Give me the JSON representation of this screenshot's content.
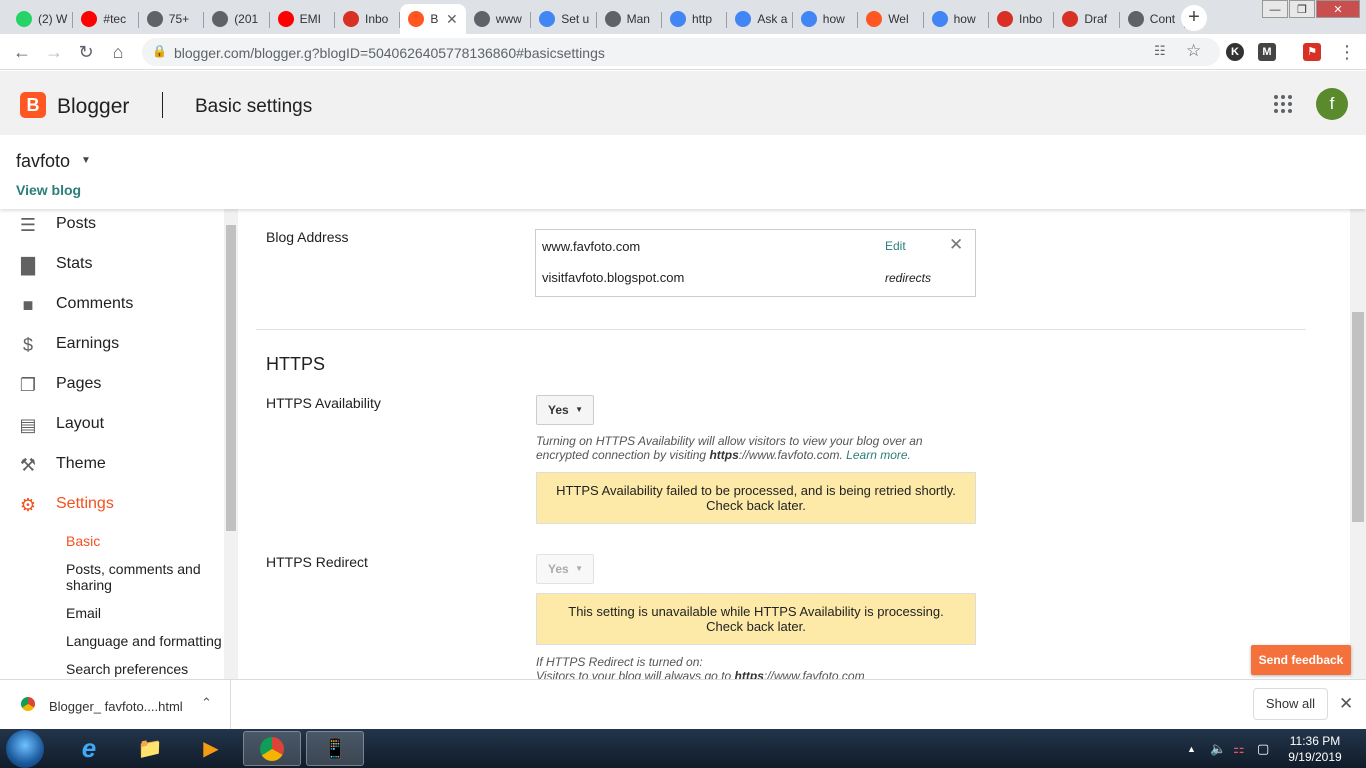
{
  "browser": {
    "tabs": [
      {
        "label": "(2) W",
        "icon": "whatsapp-icon",
        "color": "#25d366"
      },
      {
        "label": "#tec",
        "icon": "youtube-icon",
        "color": "#ff0000"
      },
      {
        "label": "75+",
        "icon": "globe-icon",
        "color": "#5f6368"
      },
      {
        "label": "(201",
        "icon": "globe-icon",
        "color": "#5f6368"
      },
      {
        "label": "EMI",
        "icon": "youtube-icon",
        "color": "#ff0000"
      },
      {
        "label": "Inbo",
        "icon": "gmail-icon",
        "color": "#d93025"
      },
      {
        "label": "B",
        "icon": "blogger-icon",
        "color": "#ff5722"
      },
      {
        "label": "www",
        "icon": "globe-icon",
        "color": "#5f6368"
      },
      {
        "label": "Set u",
        "icon": "google-icon",
        "color": "#4285f4"
      },
      {
        "label": "Man",
        "icon": "globe-icon",
        "color": "#5f6368"
      },
      {
        "label": "http",
        "icon": "google-icon",
        "color": "#4285f4"
      },
      {
        "label": "Ask a",
        "icon": "google-icon",
        "color": "#4285f4"
      },
      {
        "label": "how",
        "icon": "google-icon",
        "color": "#4285f4"
      },
      {
        "label": "Wel",
        "icon": "blogger-icon",
        "color": "#ff5722"
      },
      {
        "label": "how",
        "icon": "google-icon",
        "color": "#4285f4"
      },
      {
        "label": "Inbo",
        "icon": "gmail-icon",
        "color": "#d93025"
      },
      {
        "label": "Draf",
        "icon": "gmail-icon",
        "color": "#d93025"
      },
      {
        "label": "Cont",
        "icon": "globe-icon",
        "color": "#5f6368"
      }
    ],
    "url": "blogger.com/blogger.g?blogID=5040626405778136860#basicsettings"
  },
  "header": {
    "brand": "Blogger",
    "page_title": "Basic settings",
    "avatar_letter": "f"
  },
  "blog": {
    "name": "favfoto",
    "view_blog": "View blog"
  },
  "sidebar": {
    "items": [
      {
        "label": "Posts",
        "icon": "posts-icon"
      },
      {
        "label": "Stats",
        "icon": "stats-icon"
      },
      {
        "label": "Comments",
        "icon": "comments-icon"
      },
      {
        "label": "Earnings",
        "icon": "earnings-icon"
      },
      {
        "label": "Pages",
        "icon": "pages-icon"
      },
      {
        "label": "Layout",
        "icon": "layout-icon"
      },
      {
        "label": "Theme",
        "icon": "theme-icon"
      },
      {
        "label": "Settings",
        "icon": "gear-icon"
      }
    ],
    "sub_items": [
      "Basic",
      "Posts, comments and sharing",
      "Email",
      "Language and formatting",
      "Search preferences"
    ],
    "accent": "#f4511e"
  },
  "main": {
    "blog_address_label": "Blog Address",
    "address_primary": "www.favfoto.com",
    "edit_label": "Edit",
    "address_secondary": "visitfavfoto.blogspot.com",
    "redirects_label": "redirects",
    "https_heading": "HTTPS",
    "https_availability_label": "HTTPS Availability",
    "https_availability_value": "Yes",
    "https_note_line1": "Turning on HTTPS Availability will allow visitors to view your blog over an",
    "https_note_line2_pre": "encrypted connection by visiting",
    "https_note_bold": "https",
    "https_note_line2_post": "://www.favfoto.com.",
    "learn_more": "Learn more.",
    "warn1_line1": "HTTPS Availability failed to be processed, and is being retried shortly.",
    "warn1_line2": "Check back later.",
    "https_redirect_label": "HTTPS Redirect",
    "https_redirect_value": "Yes",
    "warn2_line1": "This setting is unavailable while HTTPS Availability is processing.",
    "warn2_line2": "Check back later.",
    "redirect_note_line1": "If HTTPS Redirect is turned on:",
    "redirect_note_line2_pre": "Visitors to your blog will always go to",
    "redirect_note_bold": "https",
    "redirect_note_line2_post": "://www.favfoto.com"
  },
  "feedback_label": "Send feedback",
  "downloads": {
    "file_name": "Blogger_ favfoto....html",
    "show_all": "Show all"
  },
  "taskbar": {
    "time": "11:36 PM",
    "date": "9/19/2019"
  }
}
